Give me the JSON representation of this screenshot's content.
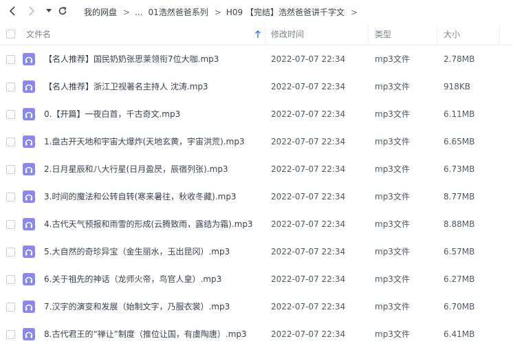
{
  "nav": {
    "breadcrumbs": [
      "我的网盘",
      "...",
      "01浩然爸爸系列",
      "H09 【完结】浩然爸爸讲千字文"
    ],
    "separator": ">"
  },
  "columns": {
    "name": "文件名",
    "modified": "修改时间",
    "type": "类型",
    "size": "大小"
  },
  "colors": {
    "accent": "#2f6fe8",
    "file_icon": "#8b88ee"
  },
  "files": [
    {
      "name": "【名人推荐】国民奶奶张思莱领衔7位大咖.mp3",
      "time": "2022-07-07 22:34",
      "type": "mp3文件",
      "size": "2.78MB"
    },
    {
      "name": "【名人推荐】浙江卫视著名主持人 沈涛.mp3",
      "time": "2022-07-07 22:34",
      "type": "mp3文件",
      "size": "918KB"
    },
    {
      "name": "0.【开篇】一夜白首，千古奇文.mp3",
      "time": "2022-07-07 22:34",
      "type": "mp3文件",
      "size": "6.11MB"
    },
    {
      "name": "1.盘古开天地和宇宙大爆炸(天地玄黄，宇宙洪荒).mp3",
      "time": "2022-07-07 22:34",
      "type": "mp3文件",
      "size": "6.65MB"
    },
    {
      "name": "2.日月星辰和八大行星(日月盈昃，辰宿列张).mp3",
      "time": "2022-07-07 22:34",
      "type": "mp3文件",
      "size": "6.73MB"
    },
    {
      "name": "3.时间的魔法和公转自转(寒来暑往，秋收冬藏).mp3",
      "time": "2022-07-07 22:34",
      "type": "mp3文件",
      "size": "8.77MB"
    },
    {
      "name": "4.古代天气预报和雨雪的形成(云腾致雨，露结为霜).mp3",
      "time": "2022-07-07 22:34",
      "type": "mp3文件",
      "size": "8.88MB"
    },
    {
      "name": "5.大自然的奇珍异宝（金生丽水，玉出昆冈）.mp3",
      "time": "2022-07-07 22:34",
      "type": "mp3文件",
      "size": "6.57MB"
    },
    {
      "name": "6.关于祖先的神话（龙师火帝，鸟官人皇）.mp3",
      "time": "2022-07-07 22:34",
      "type": "mp3文件",
      "size": "6.27MB"
    },
    {
      "name": "7.汉字的演变和发展（始制文字，乃服衣裳）.mp3",
      "time": "2022-07-07 22:34",
      "type": "mp3文件",
      "size": "6.70MB"
    },
    {
      "name": "8.古代君王的“禅让”制度（推位让国，有虞陶唐）.mp3",
      "time": "2022-07-07 22:34",
      "type": "mp3文件",
      "size": "6.41MB"
    }
  ]
}
